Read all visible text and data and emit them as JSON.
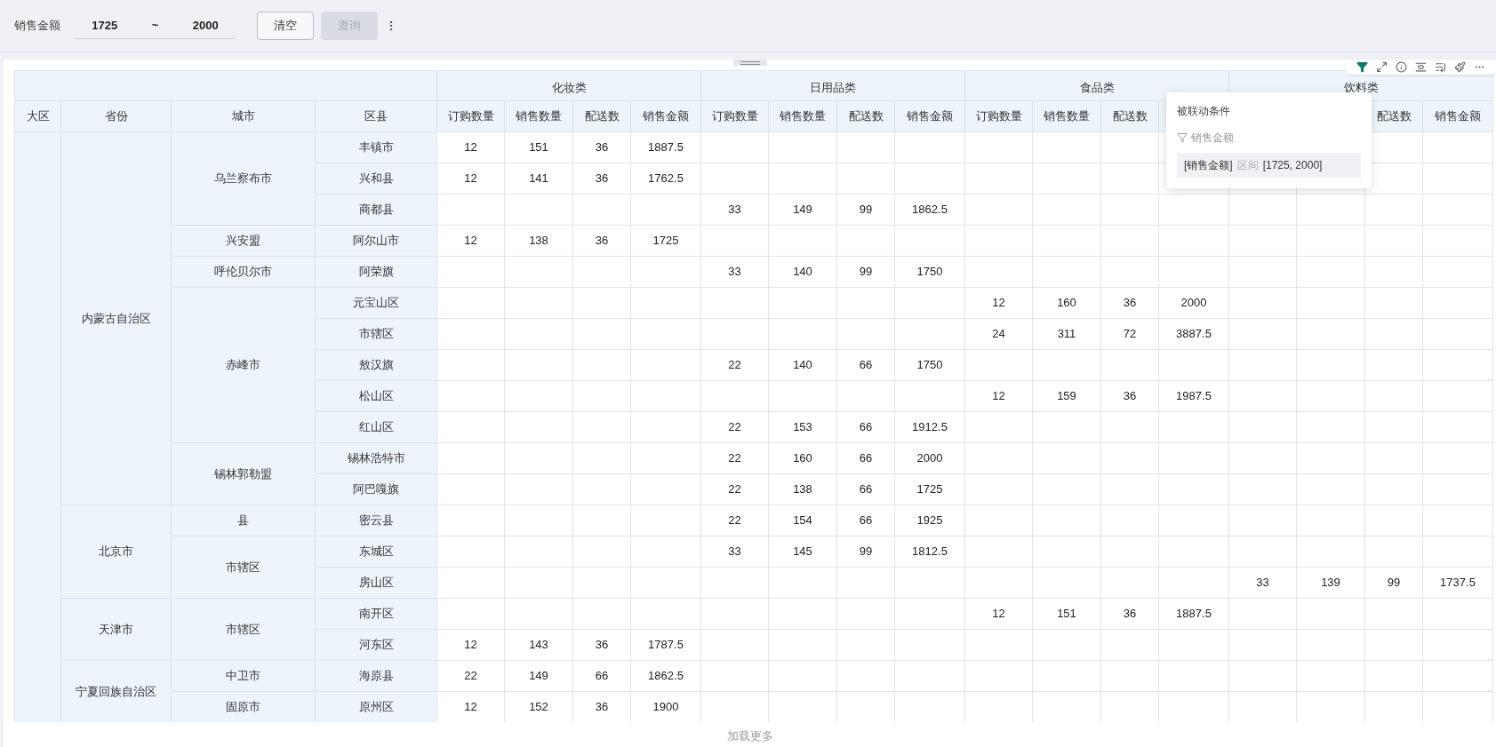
{
  "filter_bar": {
    "label": "销售金额",
    "range": {
      "from": "1725",
      "separator": "~",
      "to": "2000"
    },
    "buttons": [
      {
        "label": "清空",
        "disabled": false
      },
      {
        "label": "查询",
        "disabled": true
      }
    ]
  },
  "toolbar": {
    "filter_active": true
  },
  "popup": {
    "title": "被联动条件",
    "field": "销售金额",
    "condition": {
      "field": "[销售金额]",
      "operator": "区间",
      "value": "[1725, 2000]"
    }
  },
  "table": {
    "columns": [
      "大区",
      "省份",
      "城市",
      "区县"
    ],
    "categories": [
      {
        "name": "化妆类",
        "measures": [
          {
            "kind": "label",
            "label": "订购数量"
          },
          {
            "kind": "label",
            "label": "销售数量"
          },
          {
            "kind": "label",
            "label": "配送数"
          },
          {
            "kind": "label",
            "label": "销售金额"
          }
        ]
      },
      {
        "name": "日用品类",
        "measures": [
          {
            "kind": "label",
            "label": "订购数量"
          },
          {
            "kind": "label",
            "label": "销售数量"
          },
          {
            "kind": "label",
            "label": "配送数"
          },
          {
            "kind": "label",
            "label": "销售金额"
          }
        ]
      },
      {
        "name": "食品类",
        "measures": [
          {
            "kind": "label",
            "label": "订购数量"
          },
          {
            "kind": "label",
            "label": "销售数量"
          },
          {
            "kind": "label",
            "label": "配送数"
          },
          {
            "kind": "covered"
          }
        ]
      },
      {
        "name": "饮料类",
        "measures": [
          {
            "kind": "covered"
          },
          {
            "kind": "covered"
          },
          {
            "kind": "label",
            "label": "配送数"
          },
          {
            "kind": "label",
            "label": "销售金额"
          }
        ]
      }
    ],
    "regions": [
      {
        "provinces": [
          {
            "name": "内蒙古自治区",
            "cities": [
              {
                "name": "乌兰察布市",
                "districts": [
                  {
                    "name": "丰镇市",
                    "cosmetics": [
                      "12",
                      "151",
                      "36",
                      "1887.5"
                    ]
                  },
                  {
                    "name": "兴和县",
                    "cosmetics": [
                      "12",
                      "141",
                      "36",
                      "1762.5"
                    ]
                  },
                  {
                    "name": "商都县",
                    "daily_goods": [
                      "33",
                      "149",
                      "99",
                      "1862.5"
                    ]
                  }
                ]
              },
              {
                "name": "兴安盟",
                "districts": [
                  {
                    "name": "阿尔山市",
                    "cosmetics": [
                      "12",
                      "138",
                      "36",
                      "1725"
                    ]
                  }
                ]
              },
              {
                "name": "呼伦贝尔市",
                "districts": [
                  {
                    "name": "阿荣旗",
                    "daily_goods": [
                      "33",
                      "140",
                      "99",
                      "1750"
                    ]
                  }
                ]
              },
              {
                "name": "赤峰市",
                "districts": [
                  {
                    "name": "元宝山区",
                    "food": [
                      "12",
                      "160",
                      "36",
                      "2000"
                    ]
                  },
                  {
                    "name": "市辖区",
                    "food": [
                      "24",
                      "311",
                      "72",
                      "3887.5"
                    ]
                  },
                  {
                    "name": "敖汉旗",
                    "daily_goods": [
                      "22",
                      "140",
                      "66",
                      "1750"
                    ]
                  },
                  {
                    "name": "松山区",
                    "food": [
                      "12",
                      "159",
                      "36",
                      "1987.5"
                    ]
                  },
                  {
                    "name": "红山区",
                    "daily_goods": [
                      "22",
                      "153",
                      "66",
                      "1912.5"
                    ]
                  }
                ]
              },
              {
                "name": "锡林郭勒盟",
                "districts": [
                  {
                    "name": "锡林浩特市",
                    "daily_goods": [
                      "22",
                      "160",
                      "66",
                      "2000"
                    ]
                  },
                  {
                    "name": "阿巴嘎旗",
                    "daily_goods": [
                      "22",
                      "138",
                      "66",
                      "1725"
                    ]
                  }
                ]
              }
            ]
          },
          {
            "name": "北京市",
            "cities": [
              {
                "name": "县",
                "districts": [
                  {
                    "name": "密云县",
                    "daily_goods": [
                      "22",
                      "154",
                      "66",
                      "1925"
                    ]
                  }
                ]
              },
              {
                "name": "市辖区",
                "districts": [
                  {
                    "name": "东城区",
                    "daily_goods": [
                      "33",
                      "145",
                      "99",
                      "1812.5"
                    ]
                  },
                  {
                    "name": "房山区",
                    "beverages": [
                      "33",
                      "139",
                      "99",
                      "1737.5"
                    ]
                  }
                ]
              }
            ]
          },
          {
            "name": "天津市",
            "cities": [
              {
                "name": "市辖区",
                "districts": [
                  {
                    "name": "南开区",
                    "food": [
                      "12",
                      "151",
                      "36",
                      "1887.5"
                    ]
                  },
                  {
                    "name": "河东区",
                    "cosmetics": [
                      "12",
                      "143",
                      "36",
                      "1787.5"
                    ]
                  }
                ]
              }
            ]
          },
          {
            "name": "宁夏回族自治区",
            "cities": [
              {
                "name": "中卫市",
                "districts": [
                  {
                    "name": "海原县",
                    "cosmetics": [
                      "22",
                      "149",
                      "66",
                      "1862.5"
                    ]
                  }
                ]
              },
              {
                "name": "固原市",
                "districts": [
                  {
                    "name": "原州区",
                    "cosmetics": [
                      "12",
                      "152",
                      "36",
                      "1900"
                    ]
                  }
                ]
              }
            ]
          }
        ]
      }
    ]
  },
  "load_more": "加载更多"
}
